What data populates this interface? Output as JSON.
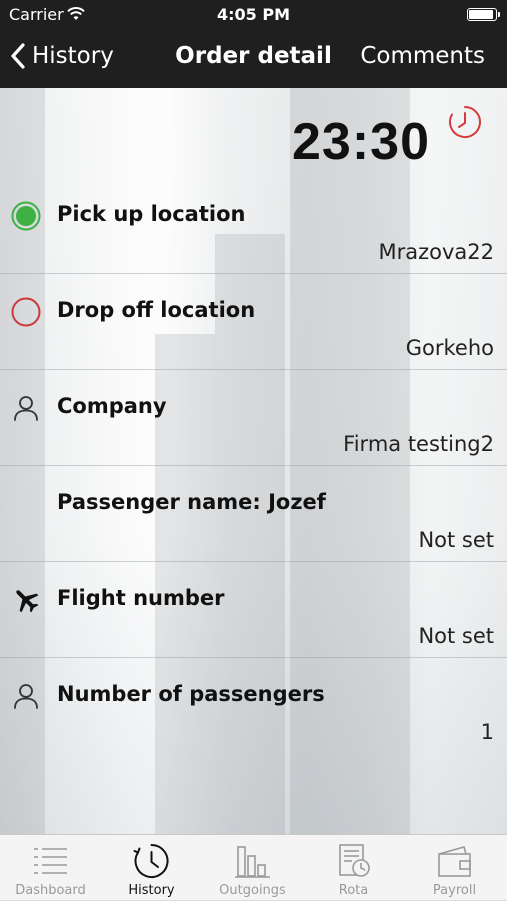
{
  "status_bar": {
    "carrier": "Carrier",
    "time": "4:05 PM",
    "battery_level": 0.95
  },
  "nav": {
    "back_label": "History",
    "title": "Order detail",
    "comments_label": "Comments"
  },
  "order": {
    "time": "23:30",
    "rows": [
      {
        "label": "Pick up location",
        "value": "Mrazova22",
        "icon": "green-dot-icon"
      },
      {
        "label": "Drop off location",
        "value": "Gorkeho",
        "icon": "red-circle-icon"
      },
      {
        "label": "Company",
        "value": "Firma testing2",
        "icon": "person-icon"
      },
      {
        "label": "Passenger name: Jozef",
        "value": "Not set",
        "icon": ""
      },
      {
        "label": "Flight number",
        "value": "Not set",
        "icon": "airplane-icon"
      },
      {
        "label": "Number of passengers",
        "value": "1",
        "icon": "person-icon"
      }
    ]
  },
  "tabs": [
    {
      "label": "Dashboard",
      "icon": "list-icon",
      "active": false
    },
    {
      "label": "History",
      "icon": "history-clock-icon",
      "active": true
    },
    {
      "label": "Outgoings",
      "icon": "bar-chart-icon",
      "active": false
    },
    {
      "label": "Rota",
      "icon": "schedule-icon",
      "active": false
    },
    {
      "label": "Payroll",
      "icon": "wallet-icon",
      "active": false
    }
  ],
  "colors": {
    "nav_bg": "#1f1f1f",
    "pickup_green": "#3cb043",
    "dropoff_red": "#c9393a",
    "accent_red": "#d43c3c"
  }
}
